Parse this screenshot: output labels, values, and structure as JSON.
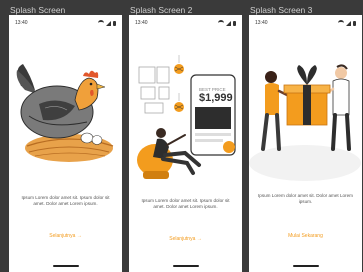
{
  "frames": [
    {
      "title": "Splash Screen",
      "status_time": "13:40",
      "body_text": "Ipsum Lorem dolor amet sit. Ipsum dolor sit amet. Dolor amet Lorem ipsum.",
      "cta": "Selanjutnya  →"
    },
    {
      "title": "Splash Screen 2",
      "status_time": "13:40",
      "price_label": "BEST PRICE",
      "price": "$1,999",
      "body_text": "Ipsum Lorem dolor amet sit. Ipsum dolor sit amet. Dolor amet Lorem ipsum.",
      "cta": "Selanjutnya  →"
    },
    {
      "title": "Splash Screen 3",
      "status_time": "13:40",
      "body_text": "Ipsum Lorem dolor amet sit. Dolor amet Lorem ipsum.",
      "cta": "Mulai Sekarang"
    }
  ],
  "colors": {
    "accent": "#f39c1e",
    "background": "#3a3a3a",
    "screen": "#ffffff"
  }
}
